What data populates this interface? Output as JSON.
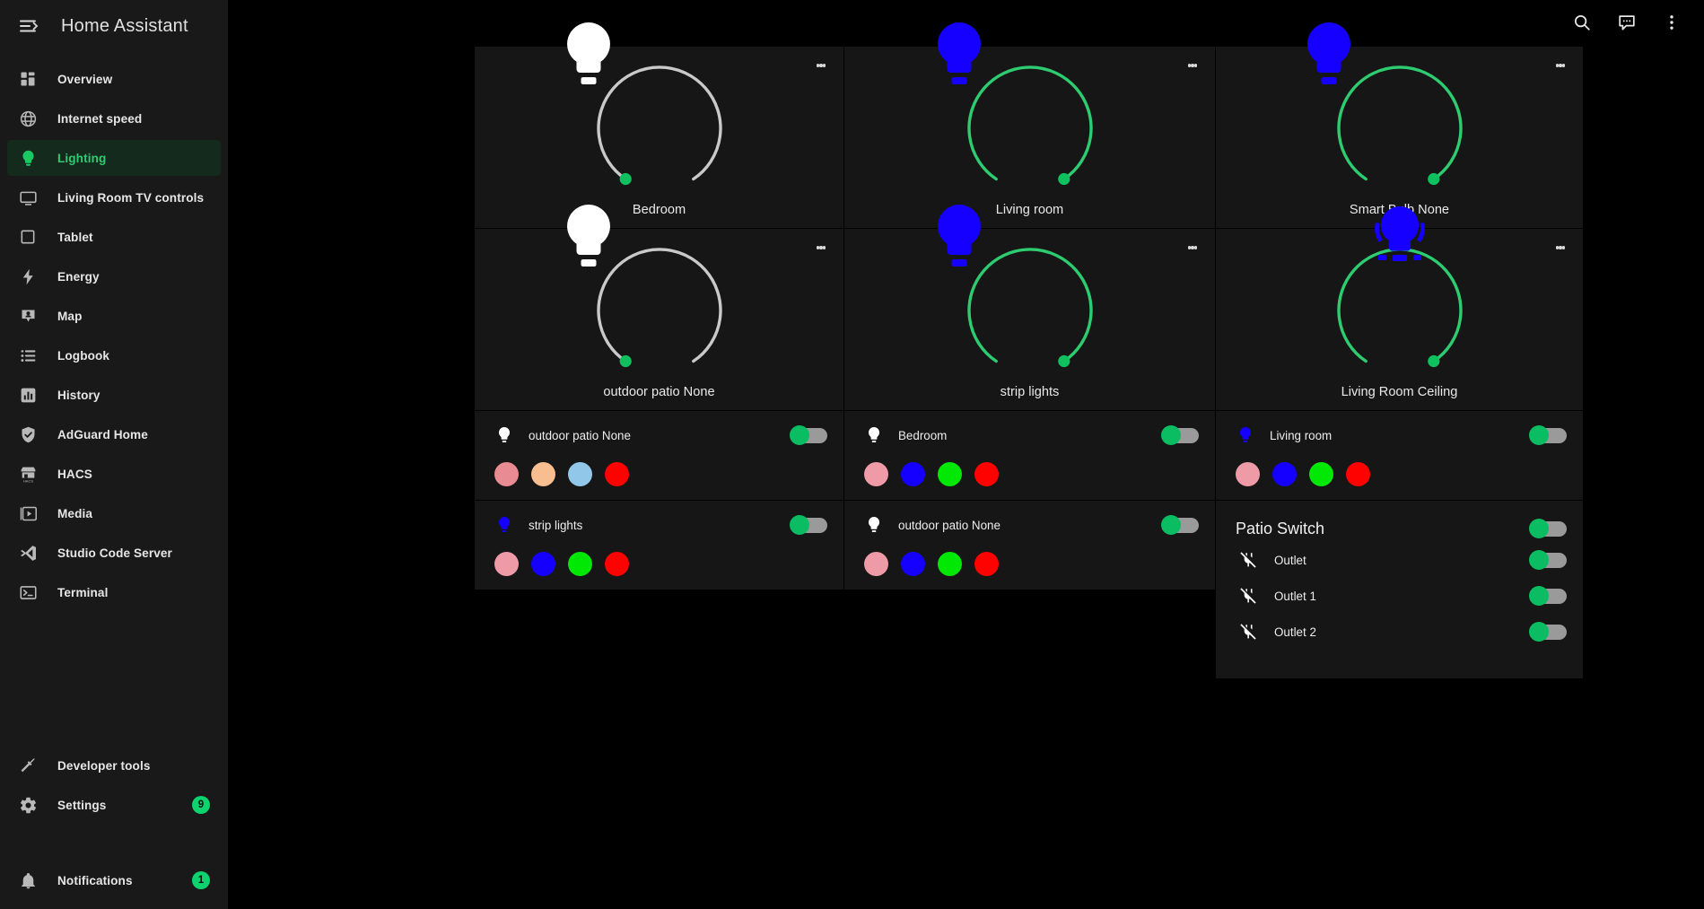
{
  "app": {
    "title": "Home Assistant",
    "menu_icon": "menu-collapse-icon"
  },
  "topbar": {
    "search_icon": "search-icon",
    "assist_icon": "assist-chat-icon",
    "overflow_icon": "overflow-menu-icon"
  },
  "sidebar": {
    "items": [
      {
        "label": "Overview",
        "icon": "view-dashboard-icon",
        "active": false
      },
      {
        "label": "Internet speed",
        "icon": "globe-icon",
        "active": false
      },
      {
        "label": "Lighting",
        "icon": "lightbulb-icon",
        "active": true
      },
      {
        "label": "Living Room TV controls",
        "icon": "television-icon",
        "active": false
      },
      {
        "label": "Tablet",
        "icon": "tablet-icon",
        "active": false
      },
      {
        "label": "Energy",
        "icon": "lightning-bolt-icon",
        "active": false
      },
      {
        "label": "Map",
        "icon": "map-marker-account-icon",
        "active": false
      },
      {
        "label": "Logbook",
        "icon": "format-list-icon",
        "active": false
      },
      {
        "label": "History",
        "icon": "chart-box-icon",
        "active": false
      },
      {
        "label": "AdGuard Home",
        "icon": "shield-check-icon",
        "active": false
      },
      {
        "label": "HACS",
        "icon": "hacs-store-icon",
        "active": false
      },
      {
        "label": "Media",
        "icon": "play-box-icon",
        "active": false
      },
      {
        "label": "Studio Code Server",
        "icon": "vscode-icon",
        "active": false
      },
      {
        "label": "Terminal",
        "icon": "console-icon",
        "active": false
      }
    ],
    "bottom_items": [
      {
        "label": "Developer tools",
        "icon": "hammer-icon",
        "badge": null
      },
      {
        "label": "Settings",
        "icon": "cog-icon",
        "badge": "9"
      },
      {
        "label": "Notifications",
        "icon": "bell-icon",
        "badge": "1"
      }
    ],
    "accent_color": "#2ecc71",
    "badge_color": "#0cd36e"
  },
  "light_tiles": [
    {
      "name": "Bedroom",
      "ring_color": "#c9c9c9",
      "bulb_color": "#ffffff",
      "brightness_pct": 100,
      "marker_color": "#0ec05e",
      "marker_side": "left"
    },
    {
      "name": "Living room",
      "ring_color": "#2ecc71",
      "bulb_color": "#1500ff",
      "brightness_pct": 100,
      "marker_color": "#0ec05e",
      "marker_side": "right"
    },
    {
      "name": "Smart Bulb None",
      "ring_color": "#2ecc71",
      "bulb_color": "#1500ff",
      "brightness_pct": 100,
      "marker_color": "#0ec05e",
      "marker_side": "right"
    },
    {
      "name": "outdoor patio None",
      "ring_color": "#c9c9c9",
      "bulb_color": "#ffffff",
      "brightness_pct": 100,
      "marker_color": "#0ec05e",
      "marker_side": "left"
    },
    {
      "name": "strip lights",
      "ring_color": "#2ecc71",
      "bulb_color": "#1500ff",
      "brightness_pct": 100,
      "marker_color": "#0ec05e",
      "marker_side": "right"
    },
    {
      "name": "Living Room Ceiling",
      "ring_color": "#2ecc71",
      "bulb_color": "#1500ff",
      "brightness_pct": 100,
      "marker_color": "#0ec05e",
      "marker_side": "right",
      "bulb_variant": "ceiling"
    }
  ],
  "color_cards": [
    {
      "name": "outdoor patio None",
      "bulb_color": "#ffffff",
      "toggle_on": true,
      "swatches": [
        "#e88b93",
        "#f8be8f",
        "#91c8ea",
        "#fe0101"
      ]
    },
    {
      "name": "Bedroom",
      "bulb_color": "#ffffff",
      "toggle_on": true,
      "swatches": [
        "#ef9ba7",
        "#1500ff",
        "#00e803",
        "#fe0101"
      ]
    },
    {
      "name": "Living room",
      "bulb_color": "#1500ff",
      "toggle_on": true,
      "swatches": [
        "#ef9ba7",
        "#1500ff",
        "#00e803",
        "#fe0101"
      ]
    },
    {
      "name": "strip lights",
      "bulb_color": "#1500ff",
      "toggle_on": true,
      "swatches": [
        "#ef9ba7",
        "#1500ff",
        "#00e803",
        "#fe0101"
      ]
    },
    {
      "name": "outdoor patio None",
      "bulb_color": "#ffffff",
      "toggle_on": true,
      "swatches": [
        "#ef9ba7",
        "#1500ff",
        "#00e803",
        "#fe0101"
      ]
    }
  ],
  "patio_switch": {
    "title": "Patio Switch",
    "toggle_on": true,
    "rows": [
      {
        "name": "Outlet",
        "icon": "power-plug-off-icon",
        "toggle_on": true
      },
      {
        "name": "Outlet 1",
        "icon": "power-plug-off-icon",
        "toggle_on": true
      },
      {
        "name": "Outlet 2",
        "icon": "power-plug-off-icon",
        "toggle_on": true
      }
    ]
  }
}
